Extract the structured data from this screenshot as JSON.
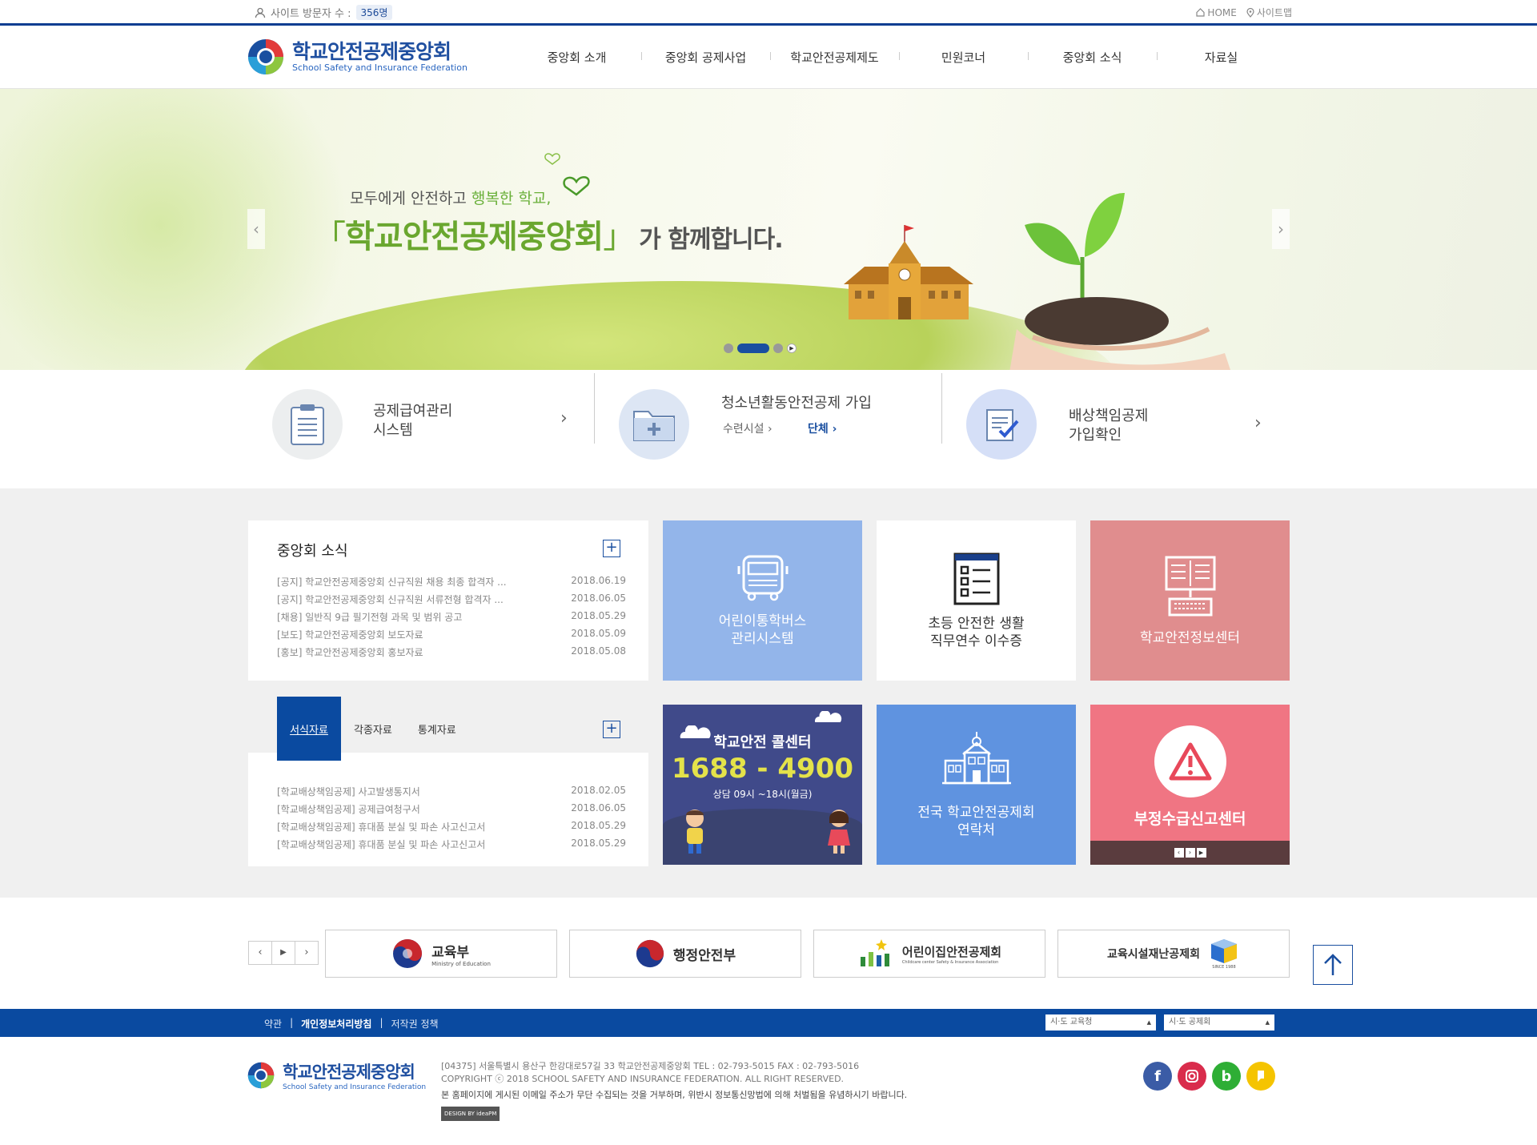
{
  "util": {
    "visitor_label": "사이트 방문자 수 :",
    "visitor_count": "356명",
    "home": "HOME",
    "sitemap": "사이트맵"
  },
  "header": {
    "logo_ko": "학교안전공제중앙회",
    "logo_en": "School Safety and Insurance Federation",
    "nav": [
      "중앙회 소개",
      "중앙회 공제사업",
      "학교안전공제제도",
      "민원코너",
      "중앙회 소식",
      "자료실"
    ]
  },
  "hero": {
    "sub_prefix": "모두에게 안전하고 ",
    "sub_highlight": "행복한 학교,",
    "bracket_open": "「",
    "main": "학교안전공제중앙회",
    "bracket_close": "」",
    "tail": "가 함께합니다.",
    "prev": "‹",
    "next": "›",
    "slides_total": 3,
    "slide_active": 2
  },
  "quick": {
    "item1": {
      "line1": "공제급여관리",
      "line2": "시스템"
    },
    "item2": {
      "title": "청소년활동안전공제 가입",
      "link1": "수련시설",
      "link2": "단체"
    },
    "item3": {
      "line1": "배상책임공제",
      "line2": "가입확인"
    }
  },
  "news": {
    "title": "중앙회 소식",
    "items": [
      {
        "text": "[공지] 학교안전공제중앙회 신규직원 채용 최종 합격자 ...",
        "date": "2018.06.19"
      },
      {
        "text": "[공지] 학교안전공제중앙회 신규직원 서류전형 합격자 ...",
        "date": "2018.06.05"
      },
      {
        "text": "[채용] 일반직 9급 필기전형 과목 및 범위 공고",
        "date": "2018.05.29"
      },
      {
        "text": "[보도] 학교안전공제중앙회 보도자료",
        "date": "2018.05.09"
      },
      {
        "text": "[홍보] 학교안전공제중앙회 홍보자료",
        "date": "2018.05.08"
      }
    ]
  },
  "forms": {
    "tabs": [
      "서식자료",
      "각종자료",
      "통계자료"
    ],
    "items": [
      {
        "text": "[학교배상책임공제] 사고발생통지서",
        "date": "2018.02.05"
      },
      {
        "text": "[학교배상책임공제] 공제급여청구서",
        "date": "2018.06.05"
      },
      {
        "text": "[학교배상책임공제] 휴대품 분실 및 파손 사고신고서",
        "date": "2018.05.29"
      },
      {
        "text": "[학교배상책임공제] 휴대품 분실 및 파손 사고신고서",
        "date": "2018.05.29"
      }
    ]
  },
  "tiles": {
    "bus": {
      "line1": "어린이통학버스",
      "line2": "관리시스템"
    },
    "training": {
      "line1": "초등 안전한 생활",
      "line2": "직무연수 이수증"
    },
    "info": {
      "label": "학교안전정보센터"
    },
    "call": {
      "title": "학교안전 콜센터",
      "number": "1688 - 4900",
      "hours": "상담 09시 ~18시(월금)"
    },
    "contacts": {
      "line1": "전국 학교안전공제회",
      "line2": "연락처"
    },
    "report": {
      "label": "부정수급신고센터"
    }
  },
  "partners": [
    {
      "name": "교육부",
      "sub": "Ministry of Education"
    },
    {
      "name": "행정안전부",
      "sub": ""
    },
    {
      "name": "어린이집안전공제회",
      "sub": "Childcare center Safety & Insurance Association"
    },
    {
      "name": "교육시설재난공제회",
      "sub": "SINCE 1988"
    }
  ],
  "footer": {
    "links": [
      "약관",
      "개인정보처리방침",
      "저작권 정책"
    ],
    "select1": "시·도 교육청",
    "select2": "시·도 공제회",
    "logo_ko": "학교안전공제중앙회",
    "logo_en": "School Safety and Insurance Federation",
    "address": "[04375] 서울특별시 용산구 한강대로57길 33 학교안전공제중앙회   TEL : 02-793-5015   FAX : 02-793-5016",
    "copyright": "COPYRIGHT ⓒ 2018 SCHOOL SAFETY AND INSURANCE FEDERATION. ALL RIGHT RESERVED.",
    "warning": "본 홈페이지에 게시된 이메일 주소가 무단 수집되는 것을 거부하며, 위반시 정보통신망법에 의해 처벌됨을 유념하시기 바랍니다.",
    "design": "DESIGN BY ideaPM"
  },
  "colors": {
    "brand": "#0a4aa0",
    "green": "#6aa72f",
    "bus_tile": "#93b5ea",
    "info_tile": "#e08d8e",
    "call_tile": "#404a8a",
    "contacts_tile": "#5f93e0",
    "report_tile": "#f07583"
  }
}
